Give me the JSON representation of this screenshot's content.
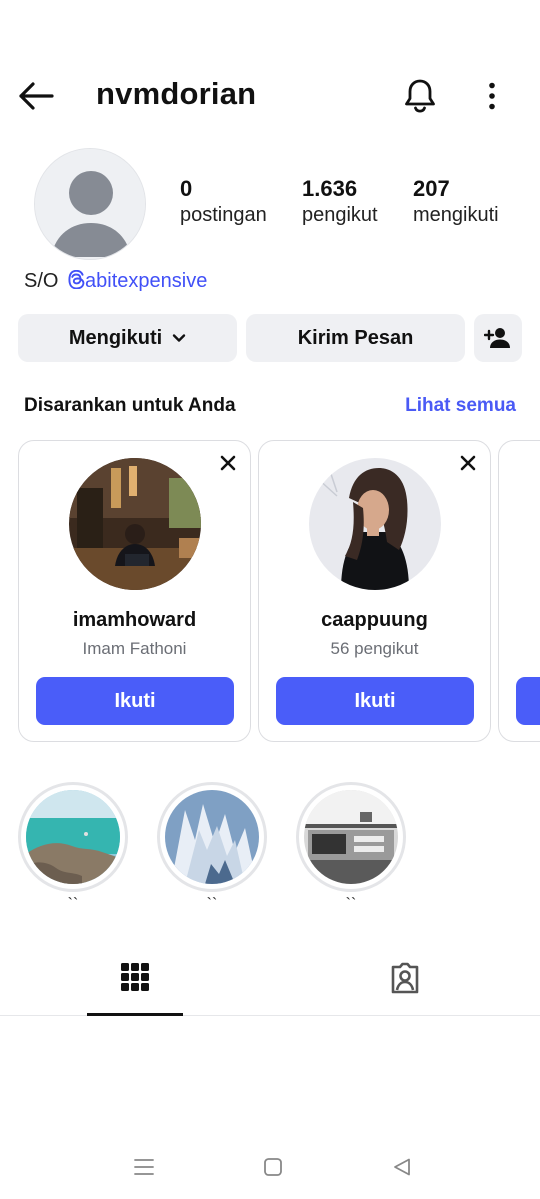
{
  "header": {
    "username": "nvmdorian",
    "back_icon": "arrow-left-icon",
    "notification_icon": "bell-icon",
    "more_icon": "more-vertical-icon"
  },
  "profile": {
    "stats": [
      {
        "value": "0",
        "label": "postingan"
      },
      {
        "value": "1.636",
        "label": "pengikut"
      },
      {
        "value": "207",
        "label": "mengikuti"
      }
    ],
    "bio_prefix": "S/O",
    "bio_link": "abitexpensive",
    "link_color": "#4150f7"
  },
  "actions": {
    "following_label": "Mengikuti",
    "message_label": "Kirim Pesan"
  },
  "suggestions": {
    "title": "Disarankan untuk Anda",
    "see_all": "Lihat semua",
    "cards": [
      {
        "username": "imamhoward",
        "subtitle": "Imam Fathoni",
        "button": "Ikuti"
      },
      {
        "username": "caappuung",
        "subtitle": "56 pengikut",
        "button": "Ikuti"
      }
    ],
    "accent": "#4a5df9"
  },
  "highlights": [
    {
      "label": "``"
    },
    {
      "label": "``"
    },
    {
      "label": "``"
    }
  ]
}
